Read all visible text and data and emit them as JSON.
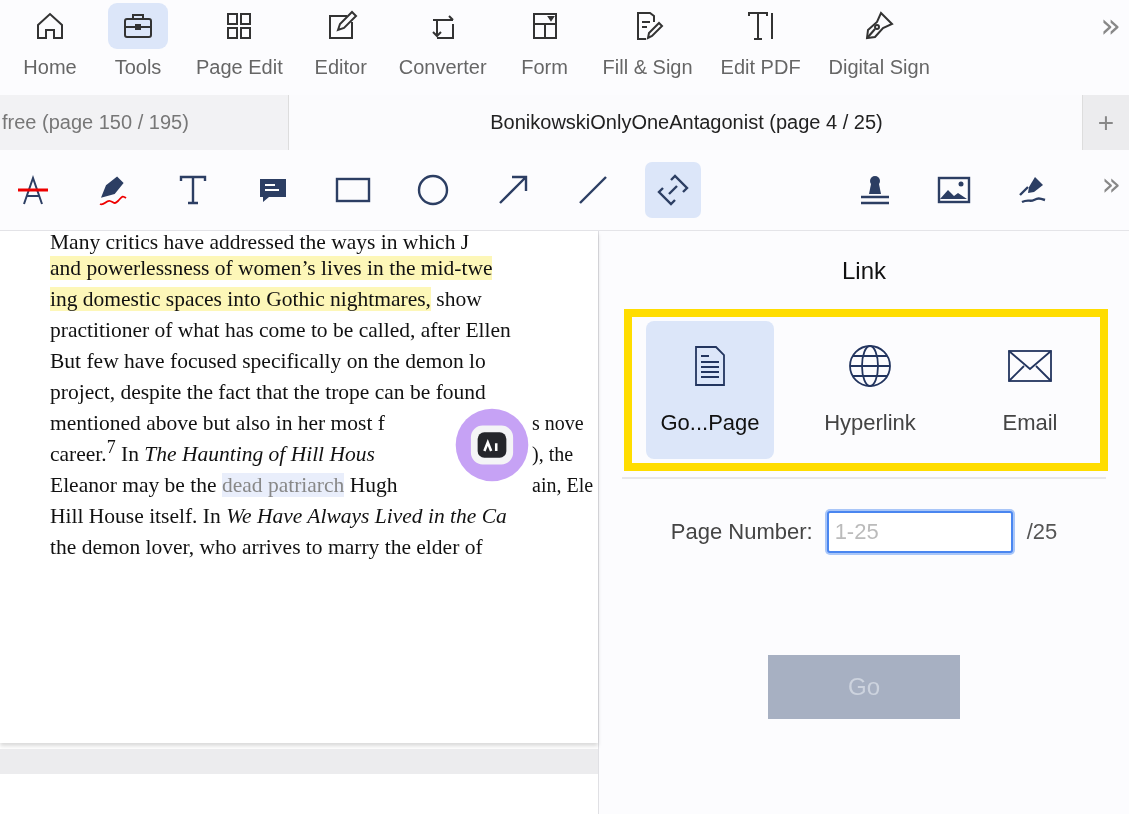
{
  "main_toolbar": {
    "items": [
      {
        "label": "Home",
        "selected": false
      },
      {
        "label": "Tools",
        "selected": true
      },
      {
        "label": "Page Edit",
        "selected": false
      },
      {
        "label": "Editor",
        "selected": false
      },
      {
        "label": "Converter",
        "selected": false
      },
      {
        "label": "Form",
        "selected": false
      },
      {
        "label": "Fill & Sign",
        "selected": false
      },
      {
        "label": "Edit PDF",
        "selected": false
      },
      {
        "label": "Digital Sign",
        "selected": false
      }
    ],
    "more": "»"
  },
  "tabs": [
    {
      "label": "free (page 150 / 195)",
      "selected": false
    },
    {
      "label": "BonikowskiOnlyOneAntagonist (page 4 / 25)",
      "selected": true
    }
  ],
  "new_tab": "+",
  "annotation_tools": {
    "items": [
      {
        "selected": false
      },
      {
        "selected": false
      },
      {
        "selected": false
      },
      {
        "selected": false
      },
      {
        "selected": false
      },
      {
        "selected": false
      },
      {
        "selected": false
      },
      {
        "selected": false
      },
      {
        "selected": true
      },
      {
        "selected": false
      },
      {
        "selected": false
      },
      {
        "selected": false
      }
    ],
    "more": "»"
  },
  "document": {
    "lines": [
      {
        "left": [
          {
            "text": "Many critics have addressed the ways in which J",
            "kind": "plain"
          }
        ]
      },
      {
        "left": [
          {
            "text": "and powerlessness of women’s lives in the mid-twe",
            "kind": "highlight"
          }
        ]
      },
      {
        "left": [
          {
            "text": "ing domestic spaces into Gothic nightmares,",
            "kind": "highlight"
          },
          {
            "text": " show",
            "kind": "plain"
          }
        ]
      },
      {
        "left": [
          {
            "text": "practitioner of what has come to be called, after Ellen",
            "kind": "plain"
          }
        ]
      },
      {
        "left": [
          {
            "text": "But few have focused specifically on the demon lo",
            "kind": "plain"
          }
        ]
      },
      {
        "left": [
          {
            "text": "project, despite the fact that the trope can be found",
            "kind": "plain"
          }
        ]
      },
      {
        "left": [
          {
            "text": "mentioned above but also in her most f",
            "kind": "plain"
          }
        ],
        "right": [
          {
            "text": "s nove",
            "kind": "plain"
          }
        ]
      },
      {
        "left": [
          {
            "text": "career.$^{7}$ In *The Haunting of Hill Hous*",
            "kind": "plain"
          }
        ],
        "right": [
          {
            "text": "), the",
            "kind": "plain"
          }
        ]
      },
      {
        "left": [
          {
            "text": "Eleanor may be the ",
            "kind": "plain"
          },
          {
            "text": "dead patriarch",
            "kind": "selected"
          },
          {
            "text": " Hugh",
            "kind": "plain"
          }
        ],
        "right": [
          {
            "text": "ain, Ele",
            "kind": "plain"
          }
        ]
      },
      {
        "left": [
          {
            "text": "Hill House itself. In *We Have Always Lived in the Ca*",
            "kind": "plain"
          }
        ]
      },
      {
        "left": [
          {
            "text": "the demon lover, who arrives to marry the elder of",
            "kind": "plain"
          }
        ]
      }
    ]
  },
  "link_panel": {
    "title": "Link",
    "options": [
      {
        "label": "Go...Page",
        "selected": true
      },
      {
        "label": "Hyperlink",
        "selected": false
      },
      {
        "label": "Email",
        "selected": false
      }
    ],
    "page_number_label": "Page Number:",
    "page_number_placeholder": "1-25",
    "page_total": "/25",
    "go_button": {
      "label": "Go",
      "disabled": true
    }
  }
}
